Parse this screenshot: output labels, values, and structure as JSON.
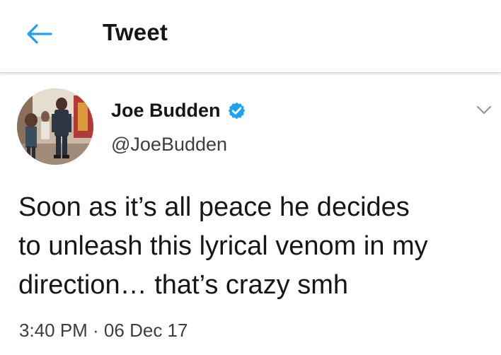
{
  "header": {
    "title": "Tweet",
    "back_icon": "arrow-left-icon",
    "accent_color": "#1DA1F2"
  },
  "author": {
    "display_name": "Joe Budden",
    "handle": "@JoeBudden",
    "verified": true,
    "verified_icon": "verified-badge-icon"
  },
  "tweet": {
    "lines": [
      "Soon as it’s all peace he decides",
      "to unleash this lyrical venom in my",
      "direction… that’s crazy smh"
    ],
    "timestamp": "3:40 PM · 06 Dec 17"
  },
  "menu": {
    "icon": "chevron-down-icon"
  }
}
